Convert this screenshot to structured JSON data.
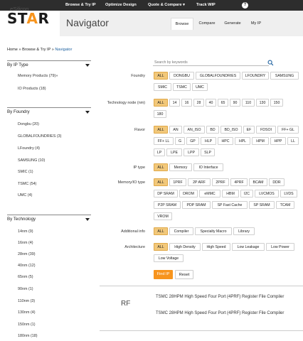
{
  "topnav": {
    "items": [
      "Browse & Try IP",
      "Optimize Design",
      "Quote & Compare ▾",
      "Track WIP"
    ],
    "help": "?"
  },
  "logo": {
    "small": "eSilicon",
    "star": "STAR"
  },
  "header": {
    "title": "Navigator",
    "tabs": [
      "Browse",
      "Compare",
      "Generate",
      "My IP"
    ],
    "active_tab": "Browse"
  },
  "breadcrumb": {
    "home": "Home",
    "sep1": " » ",
    "browse": "Browse & Try IP",
    "sep2": " » ",
    "current": "Navigator"
  },
  "sidebar": {
    "ip_type": {
      "title": "By IP Type",
      "items": [
        "Memory Products (79)»",
        "IO Products (18)"
      ]
    },
    "foundry": {
      "title": "By Foundry",
      "items": [
        "Dongbu (20)",
        "GLOBALFOUNDRIES (3)",
        "LFoundry (4)",
        "SAMSUNG (10)",
        "SMIC (1)",
        "TSMC (54)",
        "UMC (4)"
      ]
    },
    "technology": {
      "title": "By Technology",
      "items": [
        "14nm (9)",
        "16nm (4)",
        "28nm (39)",
        "40nm (12)",
        "65nm (5)",
        "90nm (1)",
        "110nm (3)",
        "130nm (4)",
        "150nm (1)",
        "180nm (18)"
      ]
    }
  },
  "search": {
    "placeholder": "Search by keywords"
  },
  "filters": {
    "foundry": {
      "label": "Foundry",
      "options": [
        "ALL",
        "DONGBU",
        "GLOBALFOUNDRIES",
        "LFOUNDRY",
        "SAMSUNG",
        "SMIC",
        "TSMC",
        "UMC"
      ]
    },
    "technology": {
      "label": "Technology node (nm)",
      "options": [
        "ALL",
        "14",
        "16",
        "28",
        "40",
        "65",
        "90",
        "110",
        "130",
        "150",
        "180"
      ]
    },
    "flavor": {
      "label": "Flavor",
      "options": [
        "ALL",
        "AN",
        "AN_ISO",
        "BD",
        "BD_ISO",
        "EF",
        "FDSOI",
        "FF+ GL",
        "FF+ LL",
        "G",
        "GP",
        "HLP",
        "HPC",
        "HPL",
        "HPM",
        "HPP",
        "LL",
        "LP",
        "LPE",
        "LPP",
        "SLP"
      ]
    },
    "ip_type": {
      "label": "IP type",
      "options": [
        "ALL",
        "Memory",
        "IO Interface"
      ]
    },
    "memory_io_type": {
      "label": "Memory/IO type",
      "options": [
        "ALL",
        "1PRF",
        "2P ARF",
        "2PRF",
        "4PRF",
        "BCAM",
        "DDR",
        "DP SRAM",
        "DROM",
        "eMMC",
        "HBM",
        "I2C",
        "LVCMOS",
        "LVDS",
        "P2P SRAM",
        "PDP SRAM",
        "SP Fast Cache",
        "SP SRAM",
        "TCAM",
        "VROM"
      ]
    },
    "additional_info": {
      "label": "Additional info",
      "options": [
        "ALL",
        "Compiler",
        "Specialty Macro",
        "Library"
      ]
    },
    "architecture": {
      "label": "Architecture",
      "options": [
        "ALL",
        "High Density",
        "High Speed",
        "Low Leakage",
        "Low Power",
        "Low Voltage"
      ]
    }
  },
  "actions": {
    "find": "Find IP",
    "reset": "Reset"
  },
  "results": {
    "category": "RF",
    "items": [
      "TSMC 28HPM High Speed Four Port (4PRF) Register File Compiler",
      "TSMC 28HPM High Speed Four Port (4PRF) Register File Compiler"
    ]
  }
}
